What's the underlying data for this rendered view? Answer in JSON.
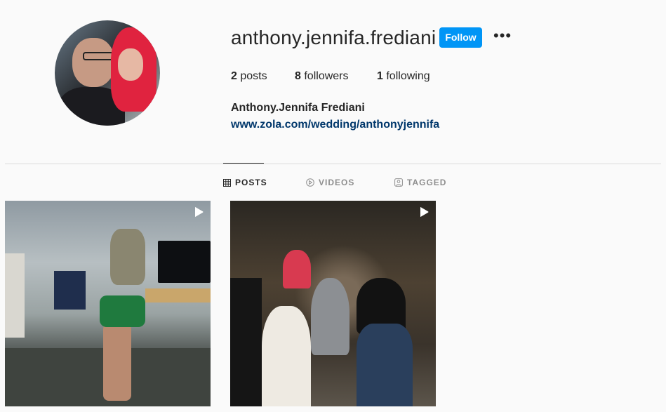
{
  "profile": {
    "username": "anthony.jennifa.frediani",
    "follow_label": "Follow",
    "more_label": "•••",
    "stats": {
      "posts_count": "2",
      "posts_label": "posts",
      "followers_count": "8",
      "followers_label": "followers",
      "following_count": "1",
      "following_label": "following"
    },
    "full_name": "Anthony.Jennifa Frediani",
    "website": "www.zola.com/wedding/anthonyjennifa"
  },
  "tabs": [
    {
      "label": "POSTS",
      "icon": "grid-icon",
      "active": true
    },
    {
      "label": "VIDEOS",
      "icon": "play-circle-icon",
      "active": false
    },
    {
      "label": "TAGGED",
      "icon": "tag-icon",
      "active": false
    }
  ],
  "posts": [
    {
      "type": "video",
      "icon": "play-icon"
    },
    {
      "type": "video",
      "icon": "play-icon"
    }
  ],
  "colors": {
    "follow_button": "#0095f6",
    "link": "#00376b",
    "background": "#fafafa",
    "divider": "#dbdbdb"
  }
}
